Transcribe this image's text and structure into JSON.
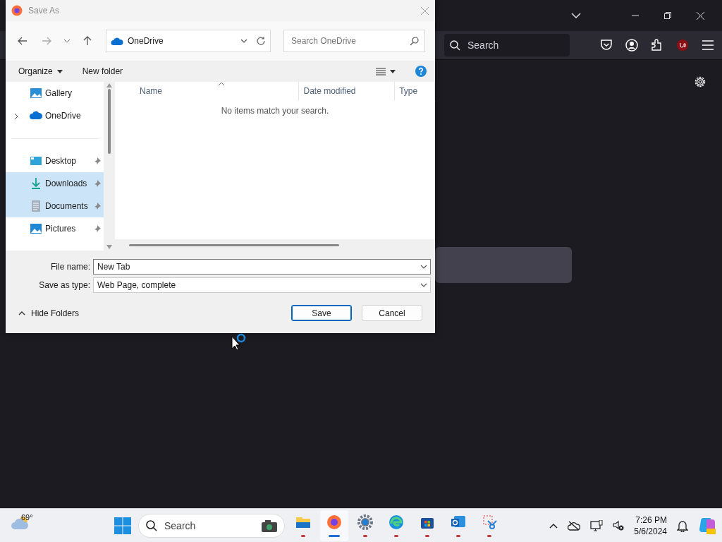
{
  "browser": {
    "search": {
      "placeholder": "Search"
    }
  },
  "dialog": {
    "title": "Save As",
    "location": "OneDrive",
    "search": {
      "placeholder": "Search OneDrive"
    },
    "toolbar": {
      "organize": "Organize",
      "new_folder": "New folder"
    },
    "sidebar": {
      "items": [
        {
          "label": "Gallery",
          "kind": "home",
          "selected": false
        },
        {
          "label": "OneDrive",
          "kind": "cloud",
          "selected": false
        },
        {
          "label": "Desktop",
          "kind": "pinned",
          "selected": false
        },
        {
          "label": "Downloads",
          "kind": "pinned",
          "selected": true
        },
        {
          "label": "Documents",
          "kind": "pinned",
          "selected": true
        },
        {
          "label": "Pictures",
          "kind": "pinned",
          "selected": false
        }
      ]
    },
    "columns": [
      "Name",
      "Date modified",
      "Type"
    ],
    "empty_message": "No items match your search.",
    "file_name": {
      "label": "File name:",
      "value": "New Tab"
    },
    "save_as_type": {
      "label": "Save as type:",
      "value": "Web Page, complete"
    },
    "hide_folders": "Hide Folders",
    "buttons": [
      {
        "label": "Save",
        "default": true
      },
      {
        "label": "Cancel",
        "default": false
      }
    ]
  },
  "taskbar": {
    "weather": "69°",
    "search": {
      "placeholder": "Search"
    },
    "apps": [
      {
        "selected": false
      },
      {
        "selected": true
      },
      {
        "selected": false
      },
      {
        "selected": false
      },
      {
        "selected": false
      },
      {
        "selected": false
      },
      {
        "selected": false
      }
    ],
    "clock": {
      "time": "7:26 PM",
      "date": "5/6/2024"
    }
  }
}
